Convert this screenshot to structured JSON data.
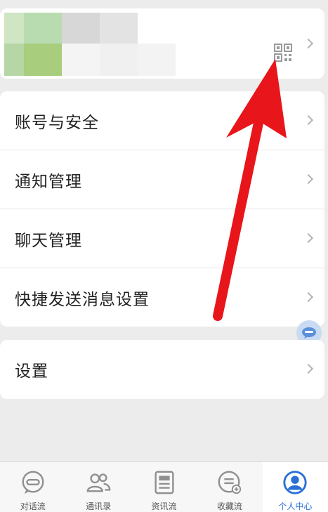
{
  "menu_group1": [
    {
      "label": "账号与安全"
    },
    {
      "label": "通知管理"
    },
    {
      "label": "聊天管理"
    },
    {
      "label": "快捷发送消息设置"
    }
  ],
  "menu_group2": [
    {
      "label": "设置"
    }
  ],
  "tabs": [
    {
      "label": "对话流",
      "icon": "chat-icon"
    },
    {
      "label": "通讯录",
      "icon": "contacts-icon"
    },
    {
      "label": "资讯流",
      "icon": "news-icon"
    },
    {
      "label": "收藏流",
      "icon": "favorites-icon"
    },
    {
      "label": "个人中心",
      "icon": "person-icon"
    }
  ],
  "colors": {
    "accent": "#2a6fd6",
    "annotation_arrow": "#e8151b",
    "background": "#ececec"
  }
}
